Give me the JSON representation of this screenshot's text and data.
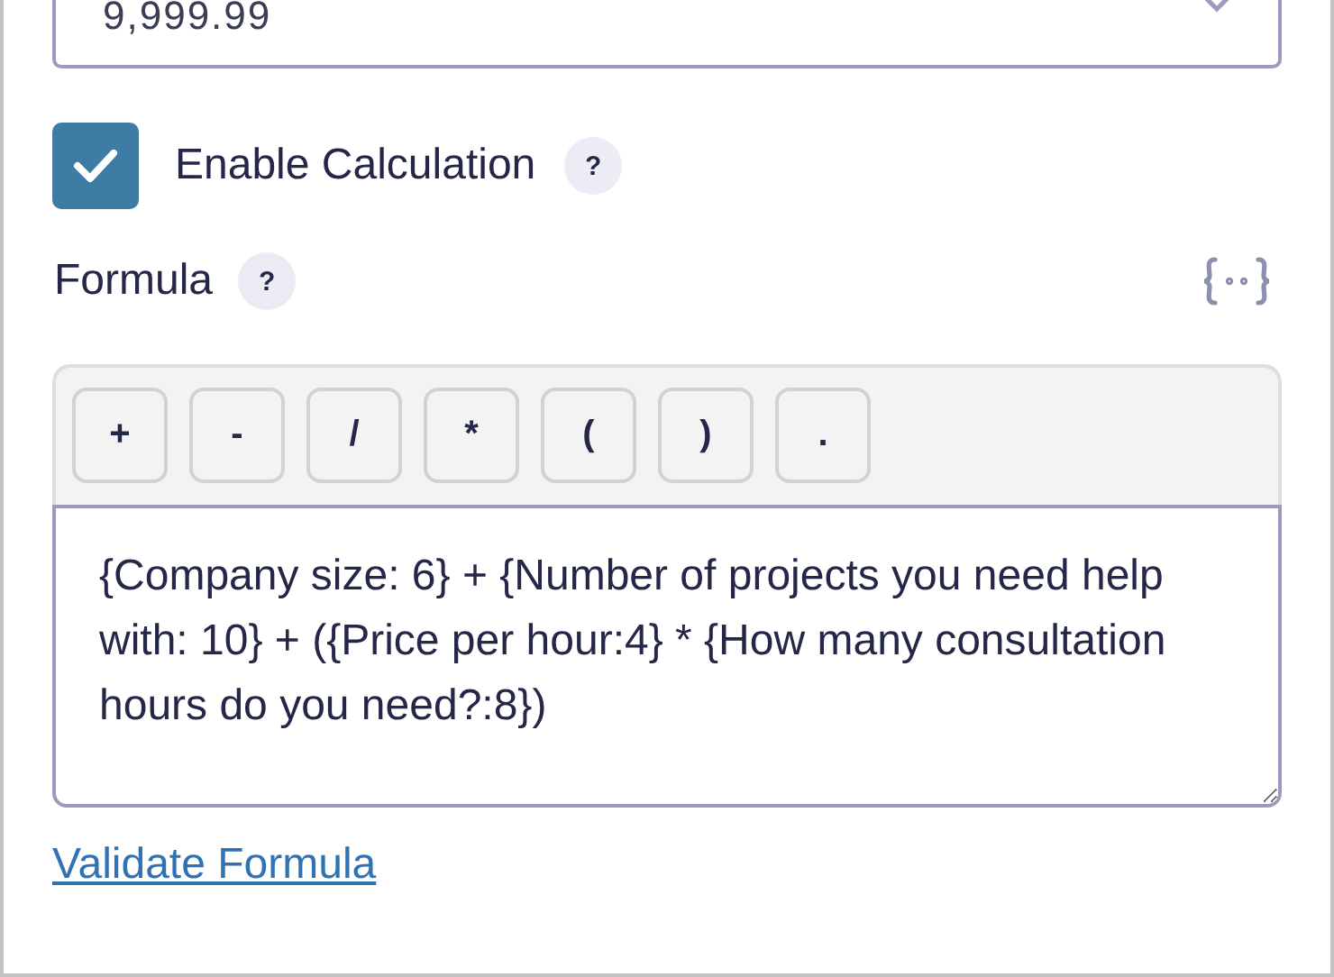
{
  "amount_field": {
    "value": "9,999.99"
  },
  "enable_calculation": {
    "label": "Enable Calculation",
    "checked": true,
    "help": "?"
  },
  "formula": {
    "label": "Formula",
    "help": "?",
    "operators": [
      "+",
      "-",
      "/",
      "*",
      "(",
      ")",
      "."
    ],
    "value": "{Company size: 6} + {Number of projects you need help with: 10} + ({Price per hour:4} * {How many consultation hours do you need?:8})"
  },
  "validate_link": "Validate Formula"
}
